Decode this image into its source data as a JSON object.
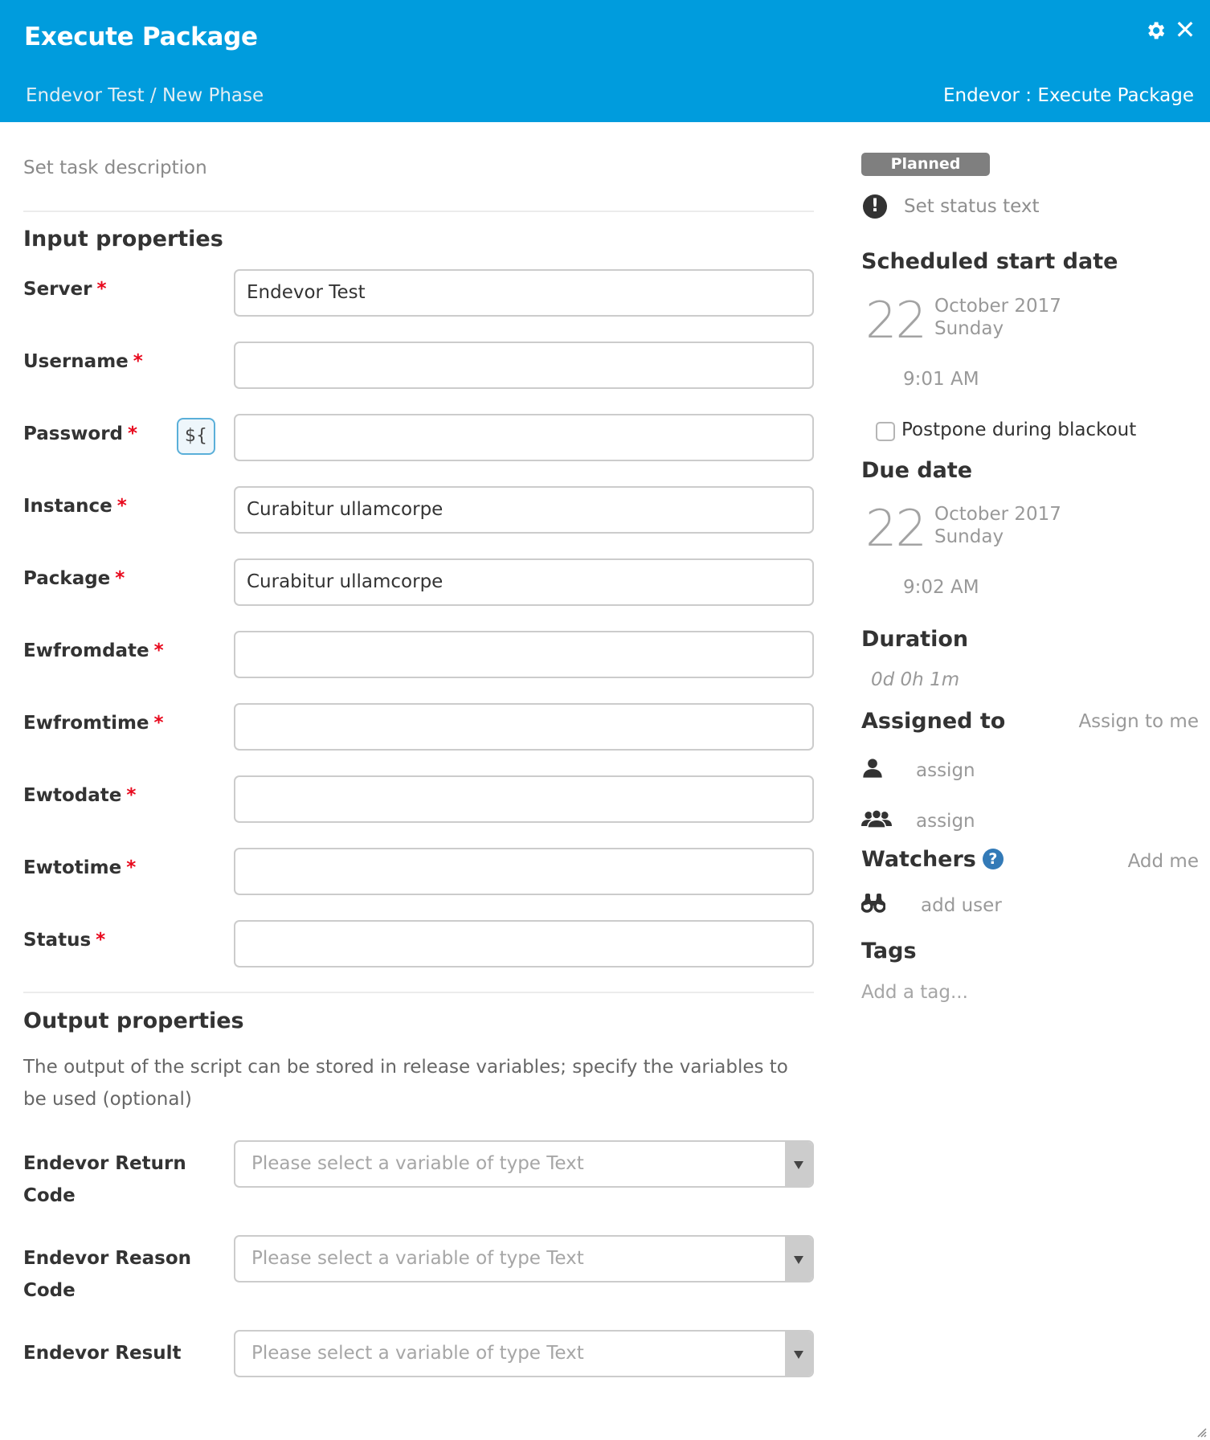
{
  "header": {
    "title": "Execute Package",
    "breadcrumb": "Endevor Test / New Phase",
    "task_type": "Endevor : Execute Package",
    "settings_icon": "gear-icon",
    "close_icon": "close-icon",
    "close_glyph": "✕",
    "background_color": "#009cdd"
  },
  "description": {
    "placeholder": "Set task description"
  },
  "input_properties": {
    "title": "Input properties",
    "required_marker": "*",
    "variable_button": "${",
    "fields": [
      {
        "label": "Server",
        "value": "Endevor Test",
        "required": true
      },
      {
        "label": "Username",
        "value": "",
        "required": true
      },
      {
        "label": "Password",
        "value": "",
        "required": true
      },
      {
        "label": "Instance",
        "value": "Curabitur ullamcorpe",
        "required": true
      },
      {
        "label": "Package",
        "value": "Curabitur ullamcorpe",
        "required": true
      },
      {
        "label": "Ewfromdate",
        "value": "",
        "required": true
      },
      {
        "label": "Ewfromtime",
        "value": "",
        "required": true
      },
      {
        "label": "Ewtodate",
        "value": "",
        "required": true
      },
      {
        "label": "Ewtotime",
        "value": "",
        "required": true
      },
      {
        "label": "Status",
        "value": "",
        "required": true
      }
    ]
  },
  "output_properties": {
    "title": "Output properties",
    "description": "The output of the script can be stored in release variables; specify the variables to be used (optional)",
    "fields": [
      {
        "label": "Endevor Return Code",
        "placeholder": "Please select a variable of type Text"
      },
      {
        "label": "Endevor Reason Code",
        "placeholder": "Please select a variable of type Text"
      },
      {
        "label": "Endevor Result",
        "placeholder": "Please select a variable of type Text"
      }
    ]
  },
  "sidebar": {
    "status_badge": "Planned",
    "status_badge_color": "#7f7f7f",
    "status_icon_glyph": "!",
    "status_text_placeholder": "Set status text",
    "scheduled_start": {
      "title": "Scheduled start date",
      "day": "22",
      "month_year": "October 2017",
      "weekday": "Sunday",
      "time": "9:01 AM"
    },
    "postpone_during_blackout": {
      "label": "Postpone during blackout",
      "checked": false
    },
    "due_date": {
      "title": "Due date",
      "day": "22",
      "month_year": "October 2017",
      "weekday": "Sunday",
      "time": "9:02 AM"
    },
    "duration": {
      "title": "Duration",
      "value": "0d 0h 1m"
    },
    "assigned_to": {
      "title": "Assigned to",
      "assign_to_me": "Assign to me",
      "user_assign": "assign",
      "team_assign": "assign"
    },
    "watchers": {
      "title": "Watchers",
      "help_glyph": "?",
      "add_me": "Add me",
      "add_user": "add user"
    },
    "tags": {
      "title": "Tags",
      "placeholder": "Add a tag..."
    }
  }
}
